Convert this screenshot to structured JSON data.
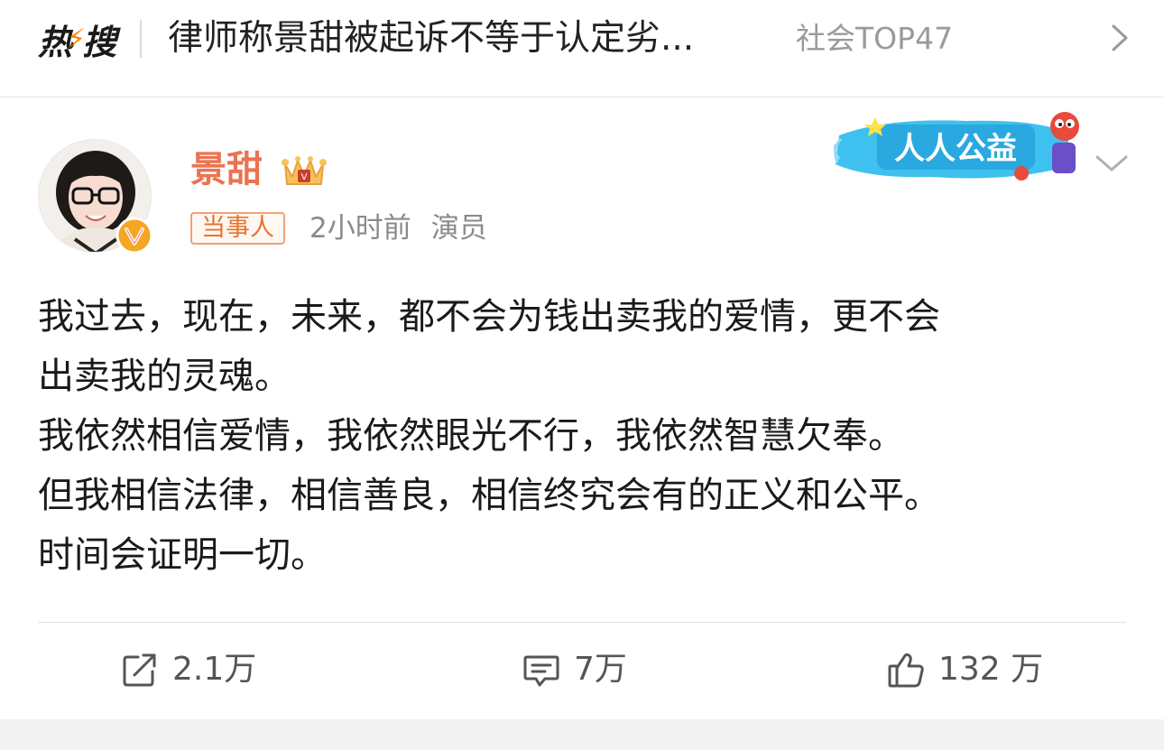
{
  "hot_search": {
    "logo_part1": "热",
    "logo_part2": "搜",
    "title": "律师称景甜被起诉不等于认定劣...",
    "rank": "社会TOP47"
  },
  "post": {
    "author": "景甜",
    "tag": "当事人",
    "time": "2小时前",
    "source": "演员",
    "badge_text": "人人公益",
    "lines": [
      "我过去，现在，未来，都不会为钱出卖我的爱情，更不会",
      "出卖我的灵魂。",
      "我依然相信爱情，我依然眼光不行，我依然智慧欠奉。",
      "但我相信法律，相信善良，相信终究会有的正义和公平。",
      "时间会证明一切。"
    ]
  },
  "actions": {
    "repost": "2.1万",
    "comment": "7万",
    "like": "132 万"
  },
  "colors": {
    "username": "#eb7350",
    "tag_border": "#f0a079",
    "hot_bolt": "#ff8200",
    "verified": "#f5a623"
  }
}
